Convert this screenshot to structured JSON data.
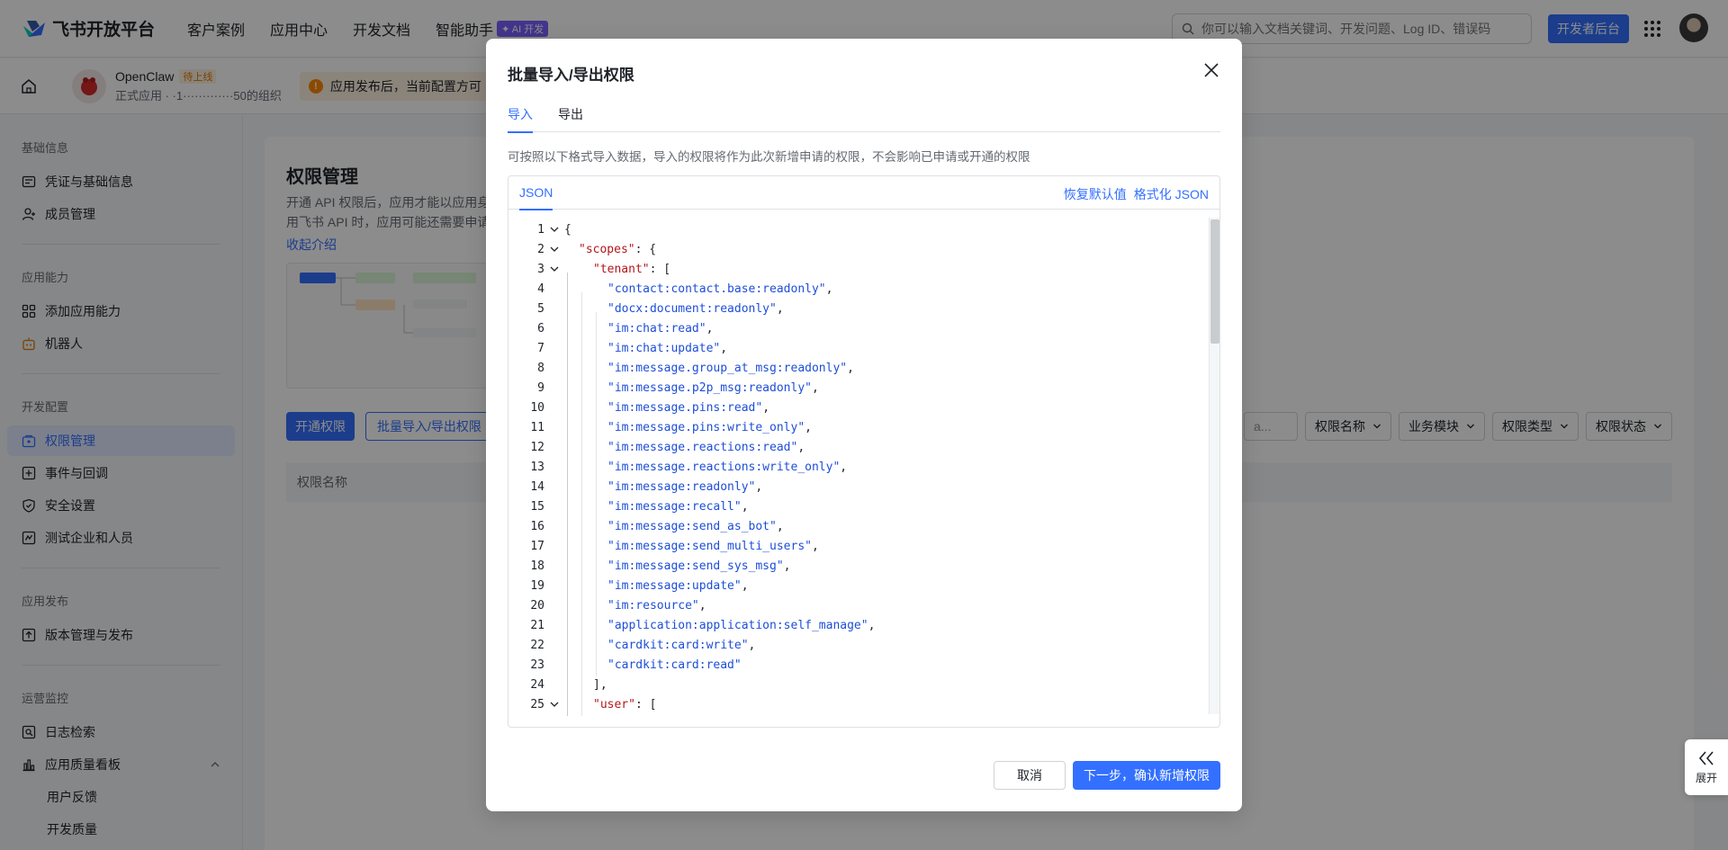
{
  "topnav": {
    "logo_text": "飞书开放平台",
    "links": [
      "客户案例",
      "应用中心",
      "开发文档",
      "智能助手"
    ],
    "ai_badge": "✦ AI 开发",
    "search_placeholder": "你可以输入文档关键词、开发问题、Log ID、错误码",
    "dev_console": "开发者后台"
  },
  "subhead": {
    "app_name": "OpenClaw",
    "app_status": "待上线",
    "app_desc": "正式应用 · ·1·············50的组织",
    "notice": "应用发布后，当前配置方可"
  },
  "sidebar": {
    "groups": [
      {
        "title": "基础信息",
        "items": [
          {
            "label": "凭证与基础信息",
            "icon": "credential-icon"
          },
          {
            "label": "成员管理",
            "icon": "member-icon"
          }
        ]
      },
      {
        "title": "应用能力",
        "items": [
          {
            "label": "添加应用能力",
            "icon": "grid-icon"
          },
          {
            "label": "机器人",
            "icon": "robot-icon"
          }
        ]
      },
      {
        "title": "开发配置",
        "items": [
          {
            "label": "权限管理",
            "icon": "permission-icon",
            "active": true
          },
          {
            "label": "事件与回调",
            "icon": "event-icon"
          },
          {
            "label": "安全设置",
            "icon": "shield-icon"
          },
          {
            "label": "测试企业和人员",
            "icon": "test-icon"
          }
        ]
      },
      {
        "title": "应用发布",
        "items": [
          {
            "label": "版本管理与发布",
            "icon": "publish-icon"
          }
        ]
      },
      {
        "title": "运营监控",
        "items": [
          {
            "label": "日志检索",
            "icon": "log-icon"
          },
          {
            "label": "应用质量看板",
            "icon": "chart-icon"
          },
          {
            "label": "用户反馈",
            "sub": true
          },
          {
            "label": "开发质量",
            "sub": true
          }
        ]
      }
    ]
  },
  "main": {
    "title": "权限管理",
    "desc": "开通 API 权限后，应用才能以应用身用飞书 API 时，应用可能还需要申请",
    "collapse": "收起介绍",
    "open_permission": "开通权限",
    "batch": "批量导入/导出权限",
    "filters": [
      "权限名称",
      "业务模块",
      "权限类型",
      "权限状态"
    ],
    "search_stub": "a...",
    "table_col": "权限名称"
  },
  "modal": {
    "title": "批量导入/导出权限",
    "tabs": [
      "导入",
      "导出"
    ],
    "hint": "可按照以下格式导入数据，导入的权限将作为此次新增申请的权限，不会影响已申请或开通的权限",
    "editor_tab": "JSON",
    "restore_default": "恢复默认值",
    "format_json": "格式化 JSON",
    "cancel": "取消",
    "next": "下一步，确认新增权限"
  },
  "code_lines": [
    {
      "n": "1",
      "text": "{",
      "fold": true
    },
    {
      "n": "2",
      "key": "scopes",
      "after": ": {",
      "indent": 1,
      "fold": true
    },
    {
      "n": "3",
      "key": "tenant",
      "after": ": [",
      "indent": 2,
      "fold": true
    },
    {
      "n": "4",
      "str": "contact:contact.base:readonly",
      "after": ",",
      "indent": 3
    },
    {
      "n": "5",
      "str": "docx:document:readonly",
      "after": ",",
      "indent": 3
    },
    {
      "n": "6",
      "str": "im:chat:read",
      "after": ",",
      "indent": 3
    },
    {
      "n": "7",
      "str": "im:chat:update",
      "after": ",",
      "indent": 3
    },
    {
      "n": "8",
      "str": "im:message.group_at_msg:readonly",
      "after": ",",
      "indent": 3
    },
    {
      "n": "9",
      "str": "im:message.p2p_msg:readonly",
      "after": ",",
      "indent": 3
    },
    {
      "n": "10",
      "str": "im:message.pins:read",
      "after": ",",
      "indent": 3
    },
    {
      "n": "11",
      "str": "im:message.pins:write_only",
      "after": ",",
      "indent": 3
    },
    {
      "n": "12",
      "str": "im:message.reactions:read",
      "after": ",",
      "indent": 3
    },
    {
      "n": "13",
      "str": "im:message.reactions:write_only",
      "after": ",",
      "indent": 3
    },
    {
      "n": "14",
      "str": "im:message:readonly",
      "after": ",",
      "indent": 3
    },
    {
      "n": "15",
      "str": "im:message:recall",
      "after": ",",
      "indent": 3
    },
    {
      "n": "16",
      "str": "im:message:send_as_bot",
      "after": ",",
      "indent": 3
    },
    {
      "n": "17",
      "str": "im:message:send_multi_users",
      "after": ",",
      "indent": 3
    },
    {
      "n": "18",
      "str": "im:message:send_sys_msg",
      "after": ",",
      "indent": 3
    },
    {
      "n": "19",
      "str": "im:message:update",
      "after": ",",
      "indent": 3
    },
    {
      "n": "20",
      "str": "im:resource",
      "after": ",",
      "indent": 3
    },
    {
      "n": "21",
      "str": "application:application:self_manage",
      "after": ",",
      "indent": 3
    },
    {
      "n": "22",
      "str": "cardkit:card:write",
      "after": ",",
      "indent": 3
    },
    {
      "n": "23",
      "str": "cardkit:card:read",
      "after": "",
      "indent": 3
    },
    {
      "n": "24",
      "text": "],",
      "indent": 2
    },
    {
      "n": "25",
      "key": "user",
      "after": ": [",
      "indent": 2,
      "fold": true
    }
  ],
  "expand_label": "展开"
}
